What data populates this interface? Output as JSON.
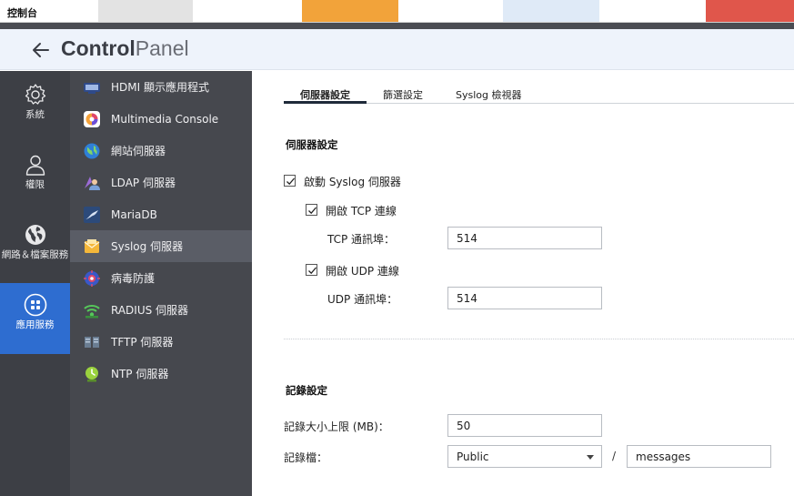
{
  "window": {
    "title": "控制台"
  },
  "header": {
    "title_bold": "Control",
    "title_light": "Panel"
  },
  "rail": {
    "items": [
      {
        "label": "系統",
        "icon": "gear-icon"
      },
      {
        "label": "權限",
        "icon": "user-icon"
      },
      {
        "label": "網路＆檔案服務",
        "icon": "globe-icon"
      },
      {
        "label": "應用服務",
        "icon": "grid-icon",
        "active": true
      }
    ]
  },
  "applist": {
    "items": [
      {
        "label": "HDMI 顯示應用程式",
        "icon": "hdmi-icon"
      },
      {
        "label": "Multimedia Console",
        "icon": "multimedia-icon"
      },
      {
        "label": "網站伺服器",
        "icon": "web-server-icon"
      },
      {
        "label": "LDAP 伺服器",
        "icon": "ldap-icon"
      },
      {
        "label": "MariaDB",
        "icon": "mariadb-icon"
      },
      {
        "label": "Syslog 伺服器",
        "icon": "syslog-icon",
        "active": true
      },
      {
        "label": "病毒防護",
        "icon": "antivirus-icon"
      },
      {
        "label": "RADIUS 伺服器",
        "icon": "radius-icon"
      },
      {
        "label": "TFTP 伺服器",
        "icon": "tftp-icon"
      },
      {
        "label": "NTP 伺服器",
        "icon": "ntp-icon"
      }
    ]
  },
  "tabs": [
    {
      "label": "伺服器設定",
      "active": true
    },
    {
      "label": "篩選設定"
    },
    {
      "label": "Syslog 檢視器"
    }
  ],
  "server_settings": {
    "title": "伺服器設定",
    "enable_syslog": {
      "label": "啟動 Syslog 伺服器",
      "checked": true
    },
    "enable_tcp": {
      "label": "開啟 TCP 連線",
      "checked": true
    },
    "tcp_port": {
      "label": "TCP 通訊埠：",
      "value": "514"
    },
    "enable_udp": {
      "label": "開啟 UDP 連線",
      "checked": true
    },
    "udp_port": {
      "label": "UDP 通訊埠：",
      "value": "514"
    }
  },
  "log_settings": {
    "title": "記錄設定",
    "max_size": {
      "label": "記錄大小上限 (MB)：",
      "value": "50"
    },
    "log_file": {
      "label": "記錄檔：",
      "folder": "Public",
      "separator": "/",
      "filename": "messages"
    }
  },
  "colors": {
    "rail_bg": "#3d3f45",
    "rail_active": "#2e6dd0",
    "applist_bg": "#46484e",
    "applist_active": "#5a5d66",
    "header_bg": "#eef3fb"
  }
}
